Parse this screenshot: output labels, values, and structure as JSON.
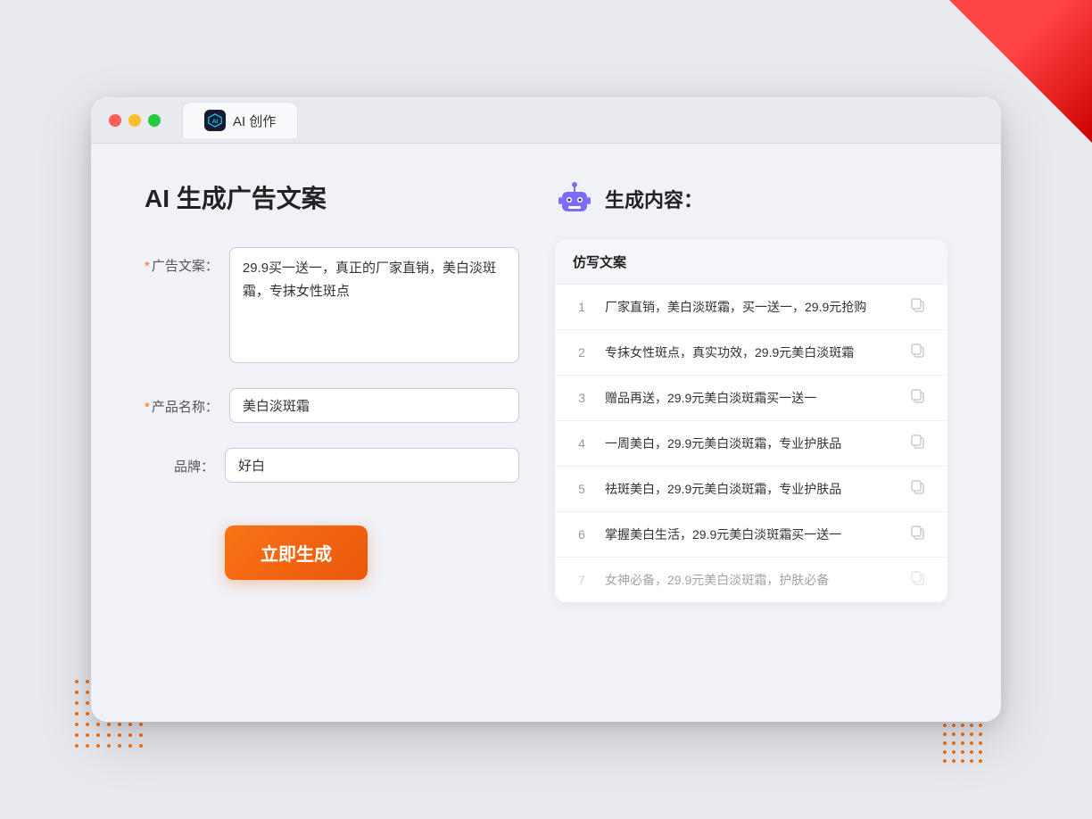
{
  "browser": {
    "tab_label": "AI 创作",
    "traffic_lights": [
      "red",
      "yellow",
      "green"
    ]
  },
  "page_title": "AI 生成广告文案",
  "form": {
    "ad_copy_label": "广告文案：",
    "ad_copy_required": "*",
    "ad_copy_value": "29.9买一送一，真正的厂家直销，美白淡斑霜，专抹女性斑点",
    "product_name_label": "产品名称：",
    "product_name_required": "*",
    "product_name_value": "美白淡斑霜",
    "brand_label": "品牌：",
    "brand_value": "好白",
    "generate_button": "立即生成"
  },
  "result": {
    "header_title": "生成内容：",
    "table_column": "仿写文案",
    "items": [
      {
        "num": "1",
        "text": "厂家直销，美白淡斑霜，买一送一，29.9元抢购",
        "dimmed": false
      },
      {
        "num": "2",
        "text": "专抹女性斑点，真实功效，29.9元美白淡斑霜",
        "dimmed": false
      },
      {
        "num": "3",
        "text": "赠品再送，29.9元美白淡斑霜买一送一",
        "dimmed": false
      },
      {
        "num": "4",
        "text": "一周美白，29.9元美白淡斑霜，专业护肤品",
        "dimmed": false
      },
      {
        "num": "5",
        "text": "祛斑美白，29.9元美白淡斑霜，专业护肤品",
        "dimmed": false
      },
      {
        "num": "6",
        "text": "掌握美白生活，29.9元美白淡斑霜买一送一",
        "dimmed": false
      },
      {
        "num": "7",
        "text": "女神必备，29.9元美白淡斑霜，护肤必备",
        "dimmed": true
      }
    ]
  }
}
